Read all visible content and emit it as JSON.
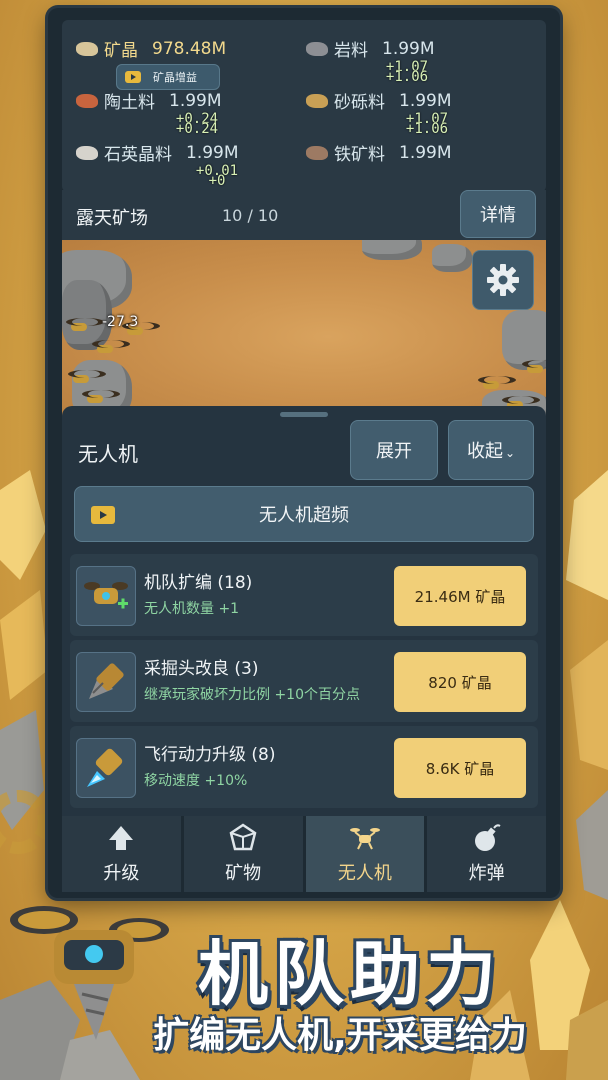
{
  "resources": [
    {
      "name": "矿晶",
      "value": "978.48M",
      "color": "#d7c59a",
      "highlight": true
    },
    {
      "name": "岩料",
      "value": "1.99M",
      "color": "#8d8f94",
      "highlight": false
    },
    {
      "name": "陶土料",
      "value": "1.99M",
      "color": "#c8643e",
      "highlight": false
    },
    {
      "name": "砂砾料",
      "value": "1.99M",
      "color": "#c9a055",
      "highlight": false
    },
    {
      "name": "石英晶料",
      "value": "1.99M",
      "color": "#d6d3cc",
      "highlight": false
    },
    {
      "name": "铁矿料",
      "value": "1.99M",
      "color": "#9d7a63",
      "highlight": false
    }
  ],
  "deltas": {
    "rock": "+1.07\n+1.06",
    "clay": "+0.24\n+0.24",
    "gravel": "+1.07\n+1.06",
    "quartz": "+0.01\n+0"
  },
  "boost_button": "矿晶增益",
  "mine": {
    "title": "露天矿场",
    "count": "10 / 10",
    "detail_button": "详情",
    "damage_text": "-27.3"
  },
  "drone_panel": {
    "title": "无人机",
    "expand_button": "展开",
    "collapse_button": "收起",
    "collapse_chevron": "⌄",
    "overclock_button": "无人机超频",
    "upgrades": [
      {
        "name": "机队扩编 (18)",
        "desc": "无人机数量 +1",
        "cost": "21.46M 矿晶",
        "icon": "drone-plus-icon"
      },
      {
        "name": "采掘头改良 (3)",
        "desc": "继承玩家破坏力比例 +10个百分点",
        "cost": "820 矿晶",
        "icon": "drill-head-icon"
      },
      {
        "name": "飞行动力升级 (8)",
        "desc": "移动速度 +10%",
        "cost": "8.6K 矿晶",
        "icon": "thruster-icon"
      }
    ]
  },
  "tabs": [
    {
      "label": "升级",
      "icon": "arrow-up-icon",
      "active": false
    },
    {
      "label": "矿物",
      "icon": "crystal-icon",
      "active": false
    },
    {
      "label": "无人机",
      "icon": "drone-icon",
      "active": true
    },
    {
      "label": "炸弹",
      "icon": "bomb-icon",
      "active": false
    }
  ],
  "promo": {
    "headline": "机队助力",
    "subline": "扩编无人机,开采更给力"
  }
}
